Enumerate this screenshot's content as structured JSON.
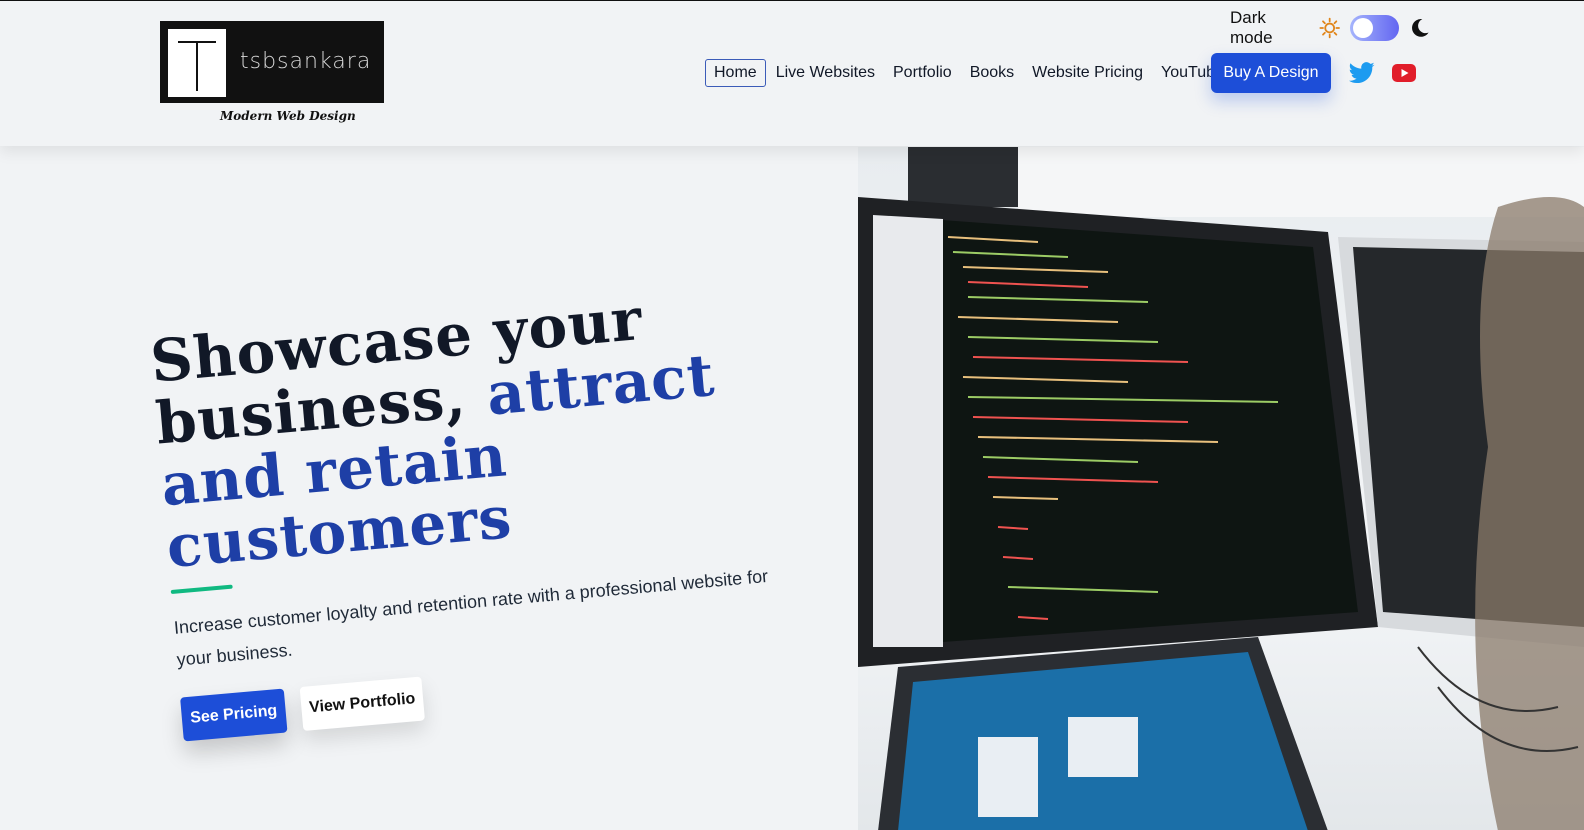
{
  "brand": {
    "name": "tsbsankara",
    "tagline": "Modern Web Design"
  },
  "theme": {
    "dark_mode_label": "Dark mode",
    "accent": "#1d4ed8",
    "headline_accent": "#1e3fa6",
    "underline": "#10b981"
  },
  "nav": {
    "items": [
      "Home",
      "Live Websites",
      "Portfolio",
      "Books",
      "Website Pricing",
      "YouTube"
    ],
    "active": "Home",
    "cta_label": "Buy A Design"
  },
  "social": {
    "twitter": "twitter-icon",
    "youtube": "youtube-icon"
  },
  "hero": {
    "headline_part1": "Showcase your business,",
    "headline_part2": "attract and retain customers",
    "subtitle": "Increase customer loyalty and retention rate with a professional website for your business.",
    "primary_cta": "See Pricing",
    "secondary_cta": "View Portfolio"
  }
}
